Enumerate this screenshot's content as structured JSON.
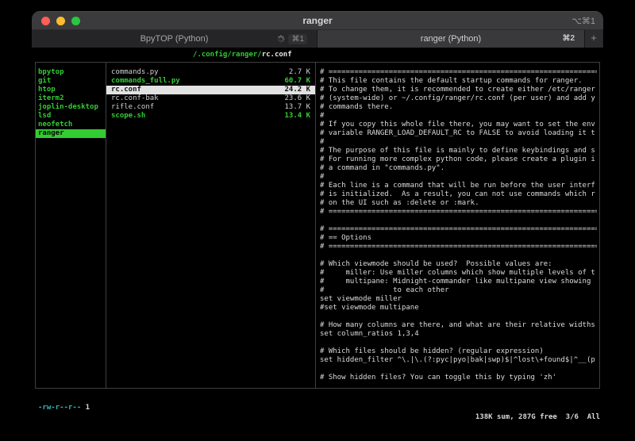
{
  "window": {
    "title": "ranger",
    "shortcut": "⌥⌘1"
  },
  "tabbar": {
    "tabs": [
      {
        "label": "BpyTOP (Python)",
        "shortcut": "⌘1",
        "active": false,
        "busy": true
      },
      {
        "label": "ranger (Python)",
        "shortcut": "⌘2",
        "active": true,
        "busy": false
      }
    ],
    "new_tab": "+"
  },
  "pathbar": {
    "dir": "/.config/ranger/",
    "file": "rc.conf"
  },
  "left_column": {
    "items": [
      "bpytop",
      "git",
      "htop",
      "iterm2",
      "joplin-desktop",
      "lsd",
      "neofetch",
      "ranger"
    ],
    "selected": "ranger"
  },
  "middle_column": {
    "files": [
      {
        "name": "commands.py",
        "size": "2.7 K",
        "type": "regular",
        "selected": false
      },
      {
        "name": "commands_full.py",
        "size": "60.7 K",
        "type": "executable",
        "selected": false
      },
      {
        "name": "rc.conf",
        "size": "24.2 K",
        "type": "regular",
        "selected": true
      },
      {
        "name": "rc.conf-bak",
        "size": "23.6 K",
        "type": "regular",
        "selected": false
      },
      {
        "name": "rifle.conf",
        "size": "13.7 K",
        "type": "regular",
        "selected": false
      },
      {
        "name": "scope.sh",
        "size": "13.4 K",
        "type": "executable",
        "selected": false
      }
    ]
  },
  "preview": {
    "lines": [
      "# ===============================================================",
      "# This file contains the default startup commands for ranger.",
      "# To change them, it is recommended to create either /etc/ranger",
      "# (system-wide) or ~/.config/ranger/rc.conf (per user) and add y",
      "# commands there.",
      "#",
      "# If you copy this whole file there, you may want to set the env",
      "# variable RANGER_LOAD_DEFAULT_RC to FALSE to avoid loading it t",
      "#",
      "# The purpose of this file is mainly to define keybindings and s",
      "# For running more complex python code, please create a plugin i",
      "# a command in \"commands.py\".",
      "#",
      "# Each line is a command that will be run before the user interf",
      "# is initialized.  As a result, you can not use commands which r",
      "# on the UI such as :delete or :mark.",
      "# ===============================================================",
      "",
      "# ===============================================================",
      "# == Options",
      "# ===============================================================",
      "",
      "# Which viewmode should be used?  Possible values are:",
      "#     miller: Use miller columns which show multiple levels of t",
      "#     multipane: Midnight-commander like multipane view showing",
      "#                to each other",
      "set viewmode miller",
      "#set viewmode multipane",
      "",
      "# How many columns are there, and what are their relative widths",
      "set column_ratios 1,3,4",
      "",
      "# Which files should be hidden? (regular expression)",
      "set hidden_filter ^\\.|\\.(?:pyc|pyo|bak|swp)$|^lost\\+found$|^__(p",
      "",
      "# Show hidden files? You can toggle this by typing 'zh'"
    ]
  },
  "statusbar": {
    "permissions": "-rw-r--r--",
    "links": " 1",
    "right": "138K sum, 287G free  3/6  All"
  }
}
